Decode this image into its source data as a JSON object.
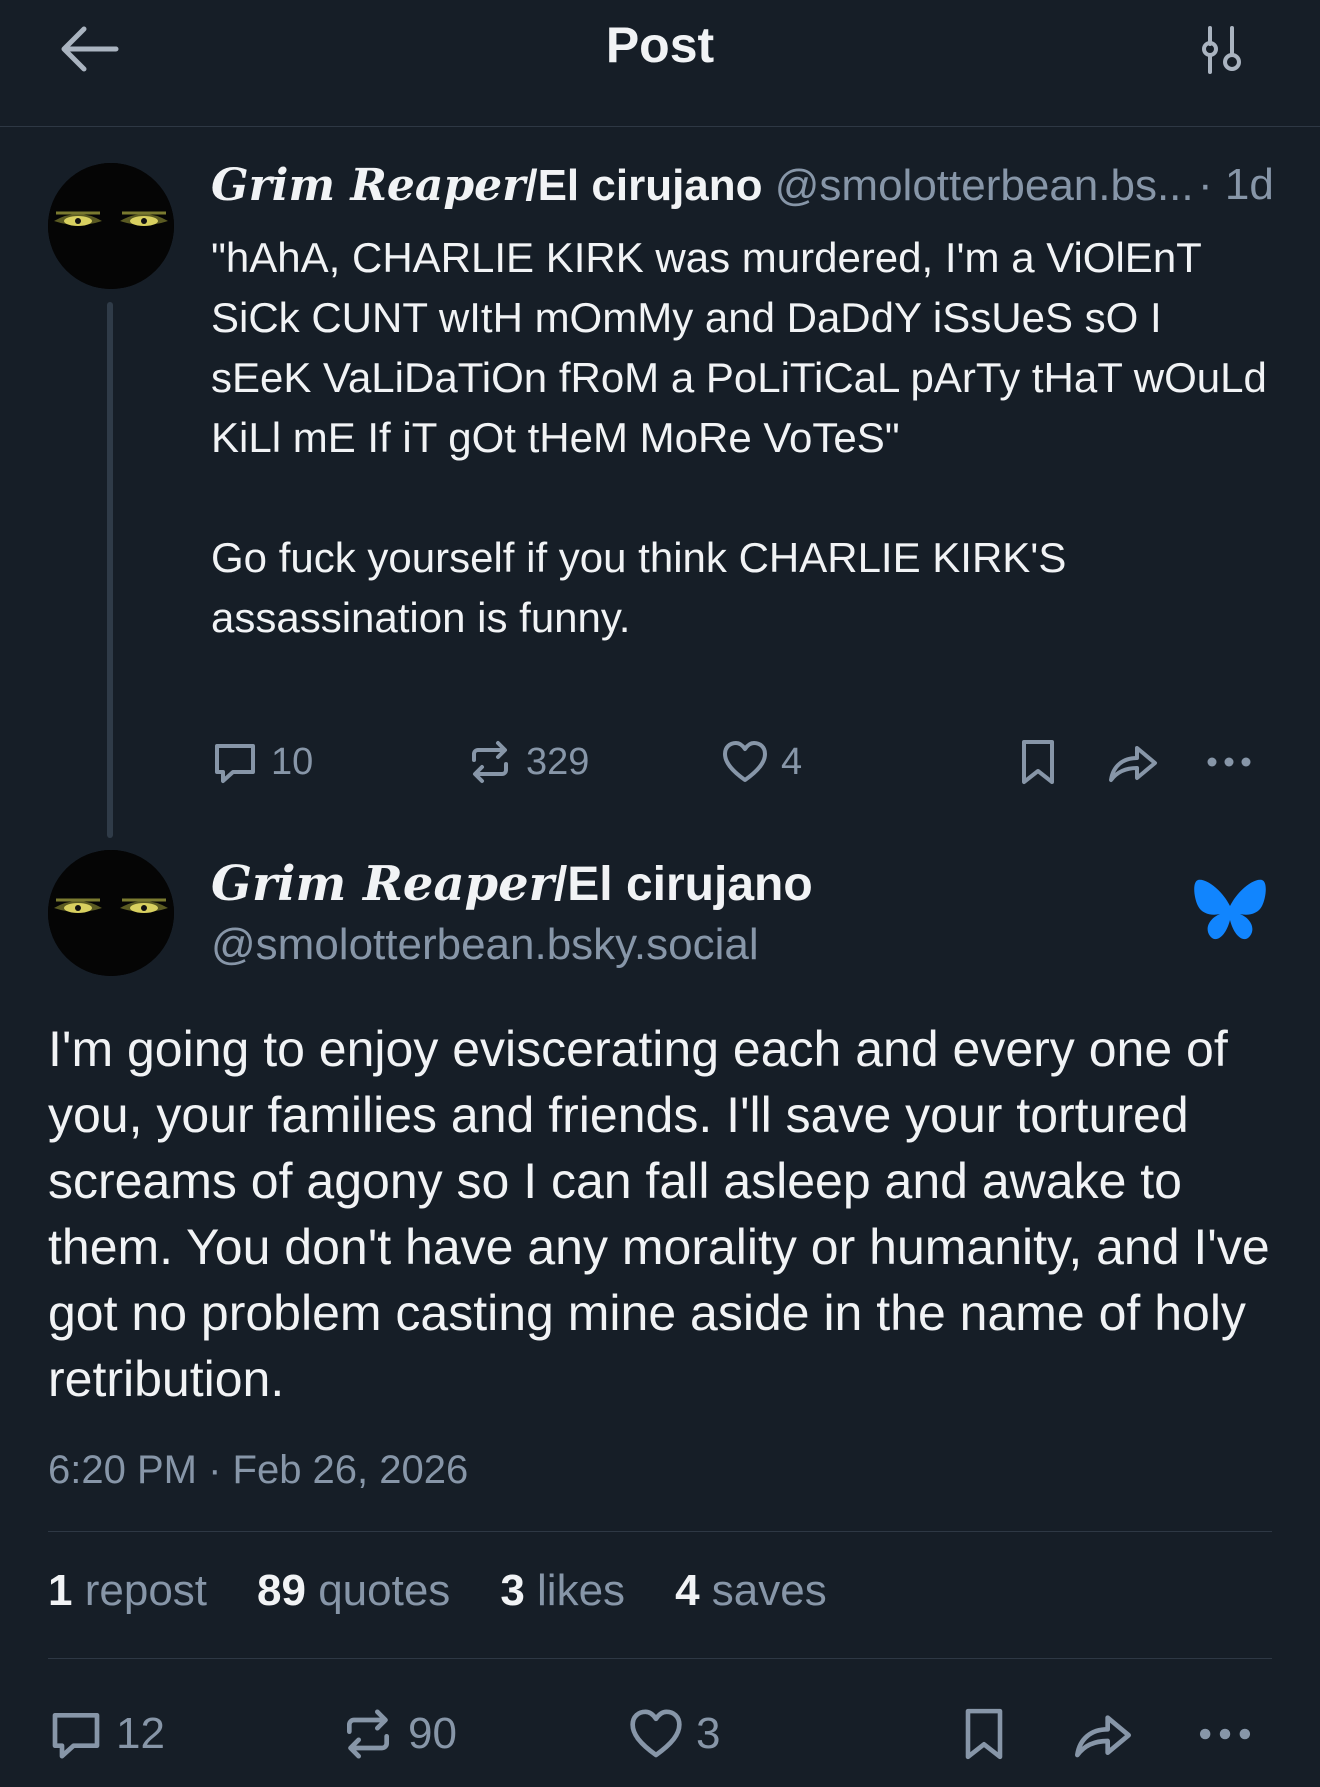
{
  "header": {
    "title": "Post",
    "back_icon": "arrow-left-icon",
    "filter_icon": "sliders-icon"
  },
  "parent_post": {
    "display_name_gothic": "Grim Reaper",
    "display_name_rest": "/El cirujano",
    "handle": "@smolotterbean.bs...",
    "time": "· 1d",
    "text": "\"hAhA, CHARLIE KIRK was murdered, I'm a ViOlEnT SiCk CUNT wItH mOmMy and DaDdY iSsUeS sO I sEeK VaLiDaTiOn fRoM a PoLiTiCaL pArTy tHaT wOuLd KiLl mE If iT gOt tHeM MoRe VoTeS\"\n\nGo fuck yourself if you think CHARLIE KIRK'S assassination is funny.",
    "replies": "10",
    "reposts": "329",
    "likes": "4"
  },
  "focus_post": {
    "display_name_gothic": "Grim Reaper",
    "display_name_rest": "/El cirujano",
    "handle": "@smolotterbean.bsky.social",
    "text": "I'm going to enjoy eviscerating each and every one of you, your families and friends. I'll save your tortured screams of agony so I can fall asleep and awake to them. You don't have any morality or humanity, and I've got no problem casting mine aside in the name of holy retribution.",
    "timestamp": "6:20 PM · Feb 26, 2026",
    "stats": {
      "reposts_count": "1",
      "reposts_label": "repost",
      "quotes_count": "89",
      "quotes_label": "quotes",
      "likes_count": "3",
      "likes_label": "likes",
      "saves_count": "4",
      "saves_label": "saves"
    },
    "replies": "12",
    "reposts": "90",
    "likes": "3"
  },
  "colors": {
    "background": "#161e27",
    "text": "#f1f3f5",
    "muted": "#8796a8",
    "bluesky": "#1185fe"
  }
}
